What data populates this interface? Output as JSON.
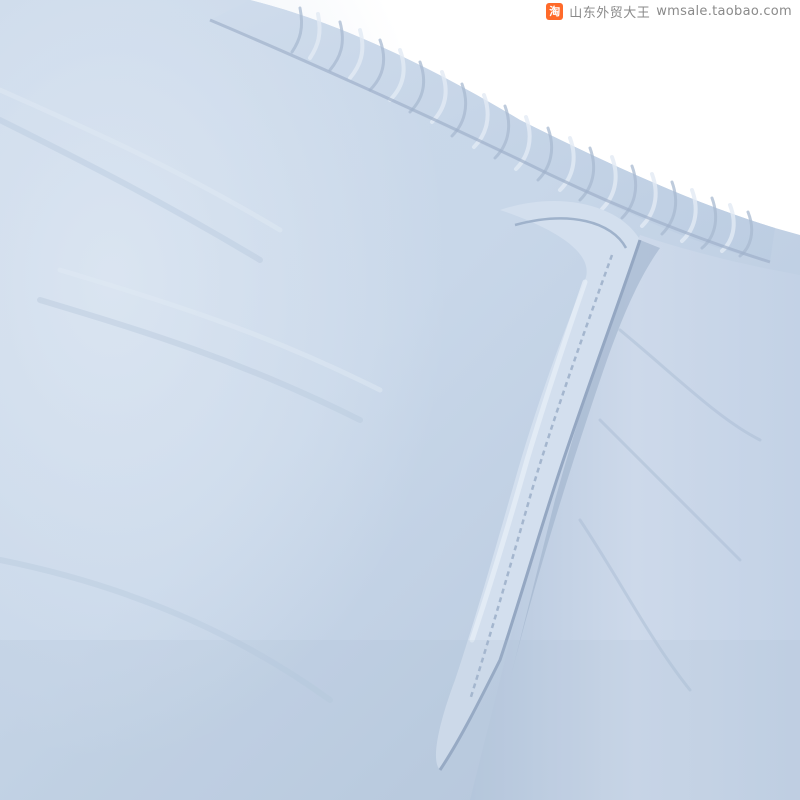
{
  "watermark": {
    "badge_char": "淘",
    "badge_color": "#ff6a2a",
    "store_name": "山东外贸大王",
    "url": "wmsale.taobao.com"
  },
  "photo": {
    "subject_icon": "fabric-icon",
    "colors": {
      "fabric_light": "#d4e0ee",
      "fabric_mid": "#c2d2e5",
      "fabric_shadow": "#a7b8cf",
      "fabric_deep": "#94a6bf",
      "highlight": "#e6eef7",
      "background": "#ffffff"
    }
  }
}
